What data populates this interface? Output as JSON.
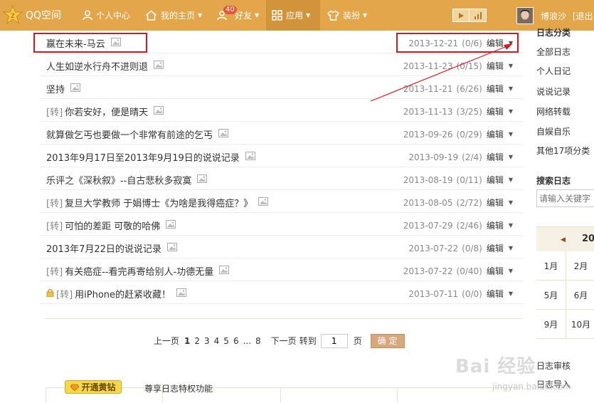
{
  "topbar": {
    "brand": "QQ空间",
    "nav": [
      {
        "label": "个人中心",
        "icon": "person-icon"
      },
      {
        "label": "我的主页",
        "icon": "home-icon"
      },
      {
        "label": "好友",
        "icon": "friends-icon",
        "badge": "40"
      },
      {
        "label": "应用",
        "icon": "apps-icon"
      },
      {
        "label": "装扮",
        "icon": "tshirt-icon"
      }
    ],
    "username": "博浪沙",
    "logout": "[退出]",
    "bg_color": "#e3a64a"
  },
  "posts": [
    {
      "tag": "",
      "title": "赢在未来-马云",
      "date": "2013-12-21",
      "comments": "(0/6)",
      "edit": "编辑",
      "locked": false
    },
    {
      "tag": "",
      "title": "人生如逆水行舟不进则退",
      "date": "2013-11-23",
      "comments": "(0/15)",
      "edit": "编辑",
      "locked": false
    },
    {
      "tag": "",
      "title": "坚持",
      "date": "2013-11-21",
      "comments": "(6/26)",
      "edit": "编辑",
      "locked": false
    },
    {
      "tag": "[转]",
      "title": "你若安好，便是晴天",
      "date": "2013-11-13",
      "comments": "(3/25)",
      "edit": "编辑",
      "locked": false
    },
    {
      "tag": "",
      "title": "就算做乞丐也要做一个非常有前途的乞丐",
      "date": "2013-09-26",
      "comments": "(0/29)",
      "edit": "编辑",
      "locked": false
    },
    {
      "tag": "",
      "title": "2013年9月17日至2013年9月19日的说说记录",
      "date": "2013-09-19",
      "comments": "(2/4)",
      "edit": "编辑",
      "locked": false
    },
    {
      "tag": "",
      "title": "乐评之《深秋叙》--自古悲秋多寂寞",
      "date": "2013-08-19",
      "comments": "(0/11)",
      "edit": "编辑",
      "locked": false
    },
    {
      "tag": "[转]",
      "title": "复旦大学教师 于娟博士《为啥是我得癌症？》",
      "date": "2013-08-05",
      "comments": "(2/72)",
      "edit": "编辑",
      "locked": false
    },
    {
      "tag": "[转]",
      "title": "可怕的差距 可敬的哈佛",
      "date": "2013-07-29",
      "comments": "(2/46)",
      "edit": "编辑",
      "locked": false
    },
    {
      "tag": "",
      "title": "2013年7月22日的说说记录",
      "date": "2013-07-22",
      "comments": "(0/8)",
      "edit": "编辑",
      "locked": false
    },
    {
      "tag": "[转]",
      "title": "有关癌症--看完再寄给别人-功德无量",
      "date": "2013-07-22",
      "comments": "(0/40)",
      "edit": "编辑",
      "locked": false
    },
    {
      "tag": "[转]",
      "title": "用iPhone的赶紧收藏！",
      "date": "2013-07-11",
      "comments": "(0/0)",
      "edit": "编辑",
      "locked": true
    }
  ],
  "pager": {
    "prev": "上一页",
    "pages": [
      "1",
      "2",
      "3",
      "4",
      "5",
      "6",
      "...",
      "8"
    ],
    "current": "1",
    "next": "下一页",
    "goto": "转到",
    "input_value": "1",
    "page_unit": "页",
    "confirm": "确 定"
  },
  "vip": {
    "button": "开通黄钻",
    "desc": "尊享日志特权功能"
  },
  "sidebar": {
    "categories_title": "日志分类",
    "categories": [
      "全部日志",
      "个人日记",
      "说说记录",
      "网络转载",
      "自娱自乐",
      "其他17项分类"
    ],
    "search_title": "搜索日志",
    "search_placeholder": "请输入关键字",
    "calendar": {
      "year": "20",
      "months": [
        "1月",
        "2月",
        "5月",
        "6月",
        "9月",
        "10月"
      ]
    },
    "footer": [
      "日志审核",
      "日志导入"
    ]
  },
  "watermark": {
    "big": "Bai 经验",
    "small": "jingyan.baidu.com"
  }
}
